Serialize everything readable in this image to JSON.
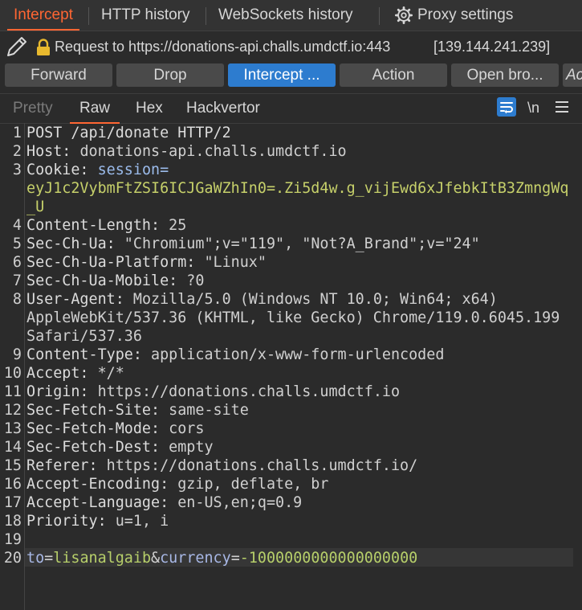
{
  "top_tabs": [
    {
      "label": "Intercept"
    },
    {
      "label": "HTTP history"
    },
    {
      "label": "WebSockets history"
    },
    {
      "label": "Proxy settings"
    }
  ],
  "request": {
    "prefix": "Request to https://donations-api.challs.umdctf.io:443",
    "ip": "[139.144.241.239]"
  },
  "buttons": {
    "forward": "Forward",
    "drop": "Drop",
    "intercept": "Intercept ...",
    "action": "Action",
    "open_browser": "Open bro...",
    "partial": "Ac"
  },
  "editor_tabs": {
    "pretty": "Pretty",
    "raw": "Raw",
    "hex": "Hex",
    "hackvertor": "Hackvertor",
    "newline_toggle": "\\n"
  },
  "colors": {
    "accent": "#ff6633",
    "primary_button": "#2d7ccf",
    "cookie_value": "#c6d06a",
    "param_value": "#b7cf6a"
  },
  "line_numbers": [
    "1",
    "2",
    "3",
    "4",
    "5",
    "6",
    "7",
    "8",
    "9",
    "10",
    "11",
    "12",
    "13",
    "14",
    "15",
    "16",
    "17",
    "18",
    "19",
    "20"
  ],
  "lines": {
    "l1": "POST /api/donate HTTP/2",
    "l2_name": "Host:",
    "l2_value": " donations-api.challs.umdctf.io",
    "l3_name": "Cookie:",
    "l3_cookie_name": " session=",
    "l3_cookie_value_1": "eyJ1c2VybmFtZSI6ICJGaWZhIn0=.Zi5d4w.g_vijEwd6xJfebkItB3ZmngWq",
    "l3_cookie_value_2": "_U",
    "l4_name": "Content-Length:",
    "l4_value": " 25",
    "l5_name": "Sec-Ch-Ua:",
    "l5_value": " \"Chromium\";v=\"119\", \"Not?A_Brand\";v=\"24\"",
    "l6_name": "Sec-Ch-Ua-Platform:",
    "l6_value": " \"Linux\"",
    "l7_name": "Sec-Ch-Ua-Mobile:",
    "l7_value": " ?0",
    "l8_name": "User-Agent:",
    "l8_value_1": " Mozilla/5.0 (Windows NT 10.0; Win64; x64)",
    "l8_value_2": "AppleWebKit/537.36 (KHTML, like Gecko) Chrome/119.0.6045.199",
    "l8_value_3": "Safari/537.36",
    "l9_name": "Content-Type:",
    "l9_value": " application/x-www-form-urlencoded",
    "l10_name": "Accept:",
    "l10_value": " */*",
    "l11_name": "Origin:",
    "l11_value": " https://donations.challs.umdctf.io",
    "l12_name": "Sec-Fetch-Site:",
    "l12_value": " same-site",
    "l13_name": "Sec-Fetch-Mode:",
    "l13_value": " cors",
    "l14_name": "Sec-Fetch-Dest:",
    "l14_value": " empty",
    "l15_name": "Referer:",
    "l15_value": " https://donations.challs.umdctf.io/",
    "l16_name": "Accept-Encoding:",
    "l16_value": " gzip, deflate, br",
    "l17_name": "Accept-Language:",
    "l17_value": " en-US,en;q=0.9",
    "l18_name": "Priority:",
    "l18_value": " u=1, i",
    "l20_k1": "to",
    "l20_eq1": "=",
    "l20_v1": "lisanalgaib",
    "l20_amp": "&",
    "l20_k2": "currency",
    "l20_eq2": "=",
    "l20_v2": "-1000000000000000000"
  }
}
